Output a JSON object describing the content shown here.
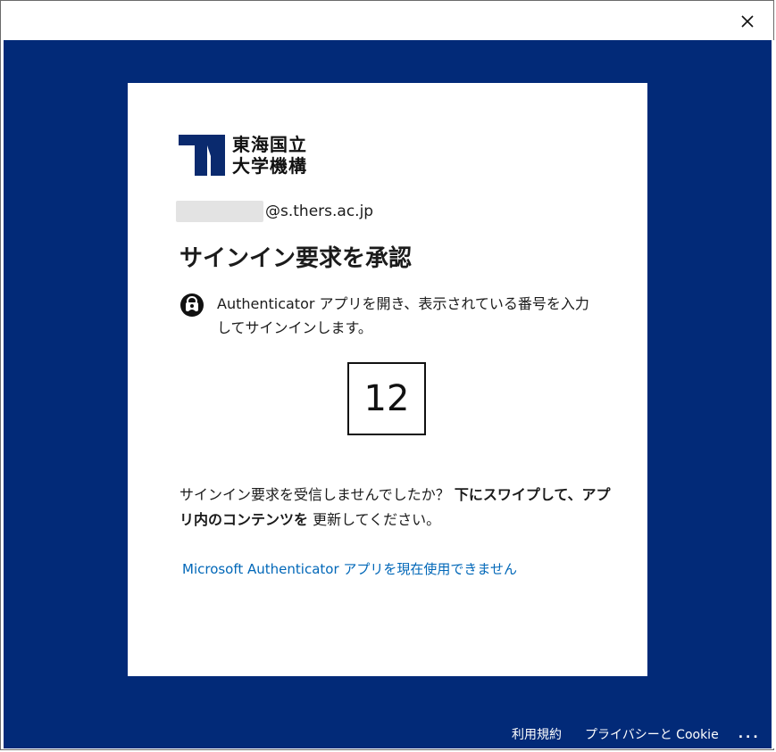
{
  "window": {
    "close_icon": "close-icon"
  },
  "org": {
    "logo_line1": "東海国立",
    "logo_line2": "大学機構",
    "logo_color": "#0a2a6e"
  },
  "account": {
    "domain": "@s.thers.ac.jp"
  },
  "page": {
    "title": "サインイン要求を承認",
    "instruction": "Authenticator アプリを開き、表示されている番号を入力してサインインします。",
    "instruction_icon": "lock-person-icon",
    "number": "12",
    "hint_prefix": "サインイン要求を受信しませんでしたか？",
    "hint_bold": "下にスワイプして、アプリ内のコンテンツを",
    "hint_suffix": " 更新してください。",
    "alt_link": "Microsoft Authenticator アプリを現在使用できません"
  },
  "footer": {
    "terms": "利用規約",
    "privacy": "プライバシーと Cookie",
    "more": "..."
  },
  "colors": {
    "backdrop": "#022a78",
    "link": "#0067b8"
  }
}
